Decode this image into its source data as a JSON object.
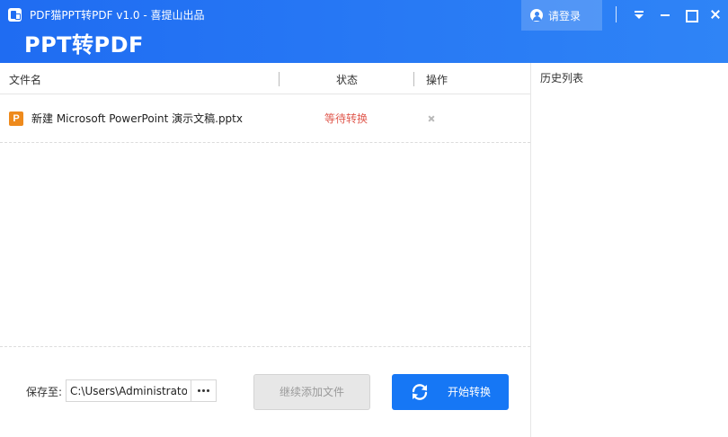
{
  "window": {
    "title": "PDF猫PPT转PDF v1.0 - 喜提山出品",
    "heading": "PPT转PDF",
    "login_label": "请登录"
  },
  "table": {
    "columns": {
      "name": "文件名",
      "status": "状态",
      "action": "操作"
    },
    "rows": [
      {
        "file_type_glyph": "P",
        "file_name": "新建 Microsoft PowerPoint 演示文稿.pptx",
        "status": "等待转换"
      }
    ]
  },
  "footer": {
    "save_label": "保存至:",
    "save_path": "C:\\Users\\Administrator",
    "add_files_label": "继续添加文件",
    "start_label": "开始转换"
  },
  "history": {
    "title": "历史列表"
  },
  "colors": {
    "header_blue": "#1f6cf2",
    "primary_button": "#1677f5",
    "status_waiting": "#e05a4f",
    "ppt_icon": "#ee8a1c"
  },
  "icons": [
    "app-logo-icon",
    "user-icon",
    "menu-icon",
    "minimize-icon",
    "maximize-icon",
    "close-icon",
    "ppt-file-icon",
    "delete-icon",
    "dots-icon",
    "refresh-icon"
  ]
}
